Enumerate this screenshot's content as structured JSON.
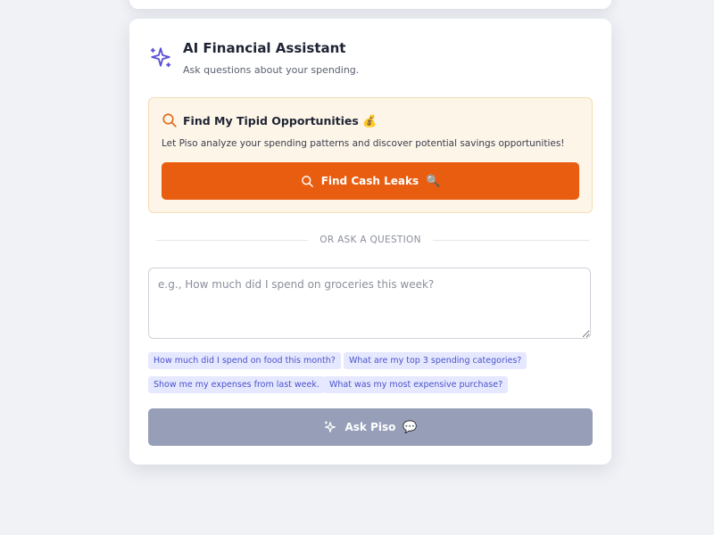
{
  "assistant": {
    "title": "AI Financial Assistant",
    "subtitle": "Ask questions about your spending."
  },
  "promo": {
    "title": "Find My Tipid Opportunities",
    "title_emoji": "💰",
    "description": "Let Piso analyze your spending patterns and discover potential savings opportunities!",
    "button_label": "Find Cash Leaks",
    "button_emoji": "🔍"
  },
  "divider": {
    "label": "OR ASK A QUESTION"
  },
  "question": {
    "value": "",
    "placeholder": "e.g., How much did I spend on groceries this week?"
  },
  "suggestions": [
    "How much did I spend on food this month?",
    "What are my top 3 spending categories?",
    "Show me my expenses from last week.",
    "What was my most expensive purchase?"
  ],
  "ask_button": {
    "label": "Ask Piso",
    "emoji": "💬"
  },
  "icons": {
    "header": "sparkle-icon",
    "promo": "search-icon",
    "leaks_button": "search-icon",
    "ask_button": "sparkle-icon"
  },
  "colors": {
    "accent_orange": "#e85d0f",
    "accent_indigo": "#4a52c8",
    "promo_background": "#fdf5e8",
    "chip_background": "#e5e8ff",
    "ask_button_disabled": "#979fb8"
  }
}
